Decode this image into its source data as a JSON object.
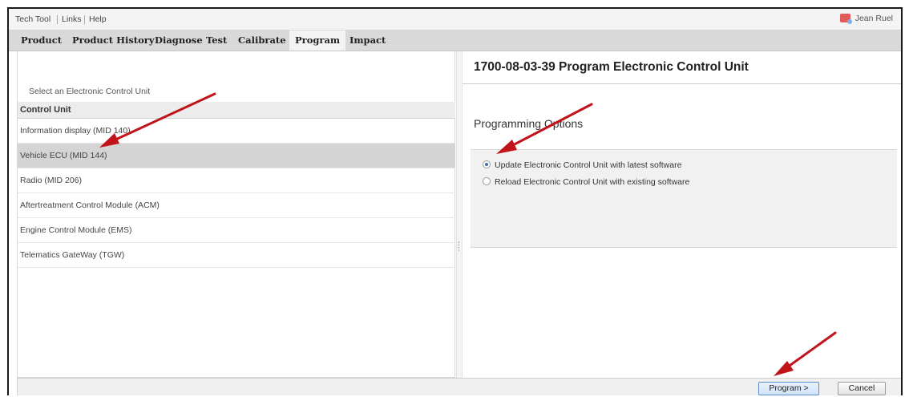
{
  "menubar": {
    "items": [
      "Tech Tool",
      "Links",
      "Help"
    ],
    "user_name": "Jean Ruel"
  },
  "tabs": [
    {
      "label": "Product",
      "active": false
    },
    {
      "label": "Product History",
      "active": false
    },
    {
      "label": "Diagnose",
      "active": false
    },
    {
      "label": "Test",
      "active": false
    },
    {
      "label": "Calibrate",
      "active": false
    },
    {
      "label": "Program",
      "active": true
    },
    {
      "label": "Impact",
      "active": false
    }
  ],
  "left": {
    "instruction": "Select an Electronic Control Unit",
    "column_header": "Control Unit",
    "rows": [
      "Information display (MID 140)",
      "Vehicle ECU (MID 144)",
      "Radio (MID 206)",
      "Aftertreatment Control Module (ACM)",
      "Engine Control Module (EMS)",
      "Telematics GateWay (TGW)"
    ],
    "selected_row": "Vehicle ECU (MID 144)"
  },
  "right": {
    "title": "1700-08-03-39 Program Electronic Control Unit",
    "options_heading": "Programming Options",
    "options": [
      {
        "label": "Update Electronic Control Unit with latest software",
        "checked": true
      },
      {
        "label": "Reload Electronic Control Unit with existing software",
        "checked": false
      }
    ]
  },
  "footer": {
    "program_label": "Program >",
    "cancel_label": "Cancel"
  },
  "colors": {
    "annotation_arrow": "#c0141a",
    "selected_row": "#d4d4d4",
    "tab_bar": "#d9d9d9"
  },
  "icons": {
    "user": "user-icon",
    "radio": "radio-icon",
    "annotation": "arrow-icon"
  }
}
